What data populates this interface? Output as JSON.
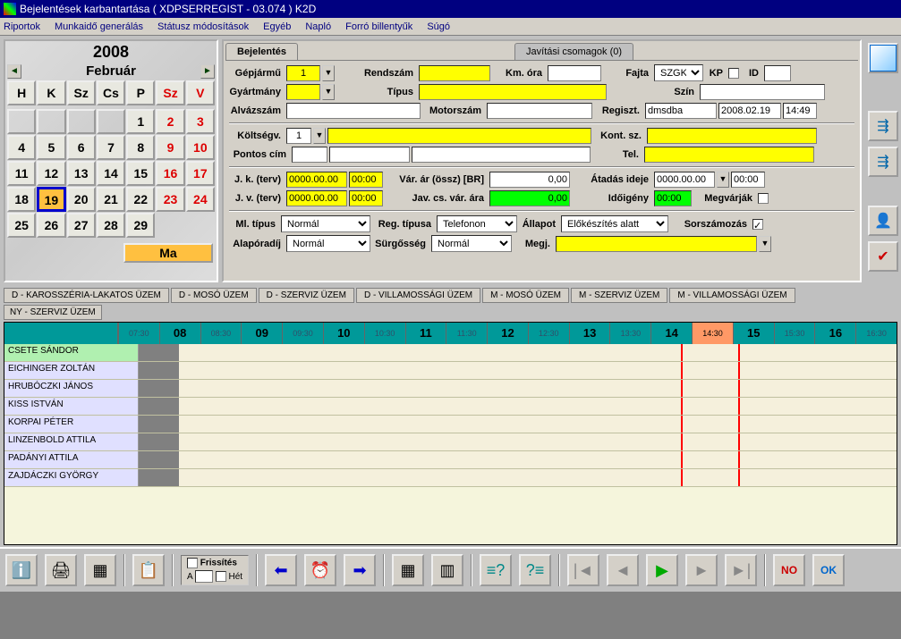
{
  "title": "Bejelentések karbantartása ( XDPSERREGIST - 03.074 )      K2D",
  "menu": [
    "Riportok",
    "Munkaidő generálás",
    "Státusz módosítások",
    "Egyéb",
    "Napló",
    "Forró billentyűk",
    "Súgó"
  ],
  "calendar": {
    "year": "2008",
    "month": "Február",
    "dow": [
      "H",
      "K",
      "Sz",
      "Cs",
      "P",
      "Sz",
      "V"
    ],
    "today_btn": "Ma",
    "selected": 19,
    "weekend_cols": [
      5,
      6
    ],
    "leading_blanks": 4,
    "days": 29
  },
  "tabs": {
    "active": "Bejelentés",
    "inactive": "Javítási csomagok (0)"
  },
  "form": {
    "gepjarmu": {
      "label": "Gépjármű",
      "value": "1"
    },
    "rendszam": {
      "label": "Rendszám",
      "value": ""
    },
    "kmora": {
      "label": "Km. óra",
      "value": ""
    },
    "fajta": {
      "label": "Fajta",
      "value": "SZGK"
    },
    "kp": {
      "label": "KP"
    },
    "id": {
      "label": "ID"
    },
    "gyartmany": {
      "label": "Gyártmány",
      "value": ""
    },
    "tipus": {
      "label": "Típus",
      "value": ""
    },
    "szin": {
      "label": "Szín",
      "value": ""
    },
    "alvazszam": {
      "label": "Alvázszám",
      "value": ""
    },
    "motorszam": {
      "label": "Motorszám",
      "value": ""
    },
    "regiszt": {
      "label": "Regiszt.",
      "user": "dmsdba",
      "date": "2008.02.19",
      "time": "14:49"
    },
    "koltsegv": {
      "label": "Költségv.",
      "value": "1"
    },
    "kontsz": {
      "label": "Kont. sz.",
      "value": ""
    },
    "pontoscim": {
      "label": "Pontos cím",
      "value": ""
    },
    "tel": {
      "label": "Tel.",
      "value": ""
    },
    "jkterv": {
      "label": "J. k. (terv)",
      "date": "0000.00.00",
      "time": "00:00"
    },
    "jvterv": {
      "label": "J. v. (terv)",
      "date": "0000.00.00",
      "time": "00:00"
    },
    "vararossz": {
      "label": "Vár. ár (össz) [BR]",
      "value": "0,00"
    },
    "javcsvarara": {
      "label": "Jav. cs. vár. ára",
      "value": "0,00"
    },
    "atadasideje": {
      "label": "Átadás ideje",
      "date": "0000.00.00",
      "time": "00:00"
    },
    "idoigeny": {
      "label": "Időigény",
      "value": "00:00"
    },
    "megvarjak": {
      "label": "Megvárják"
    },
    "mltipus": {
      "label": "Ml. típus",
      "value": "Normál"
    },
    "alaporadij": {
      "label": "Alapóradíj",
      "value": "Normál"
    },
    "regtipusa": {
      "label": "Reg. típusa",
      "value": "Telefonon"
    },
    "surgosseg": {
      "label": "Sürgősség",
      "value": "Normál"
    },
    "allapot": {
      "label": "Állapot",
      "value": "Előkészítés alatt"
    },
    "sorszamozas": {
      "label": "Sorszámozás"
    },
    "megj": {
      "label": "Megj.",
      "value": ""
    }
  },
  "plant_tabs": [
    "D - KAROSSZÉRIA-LAKATOS ÜZEM",
    "D - MOSÓ ÜZEM",
    "D - SZERVIZ ÜZEM",
    "D - VILLAMOSSÁGI ÜZEM",
    "M - MOSÓ ÜZEM",
    "M - SZERVIZ ÜZEM",
    "M - VILLAMOSSÁGI ÜZEM"
  ],
  "selected_plant": "NY - SZERVIZ ÜZEM",
  "time_slots": [
    "07:30",
    "08",
    "08:30",
    "09",
    "09:30",
    "10",
    "10:30",
    "11",
    "11:30",
    "12",
    "12:30",
    "13",
    "13:30",
    "14",
    "14:30",
    "15",
    "15:30",
    "16",
    "16:30"
  ],
  "highlight_slot": "14:30",
  "workers": [
    {
      "name": "CSETE SÁNDOR",
      "green": true
    },
    {
      "name": "EICHINGER ZOLTÁN"
    },
    {
      "name": "HRUBÓCZKI JÁNOS"
    },
    {
      "name": "KISS ISTVÁN"
    },
    {
      "name": "KORPAI PÉTER"
    },
    {
      "name": "LINZENBOLD ATTILA"
    },
    {
      "name": "PADÁNYI ATTILA"
    },
    {
      "name": "ZAJDÁCZKI GYÖRGY"
    }
  ],
  "bottom": {
    "frissites": "Frissítés",
    "a_label": "A",
    "het_label": "Hét",
    "no": "NO",
    "ok": "OK"
  }
}
